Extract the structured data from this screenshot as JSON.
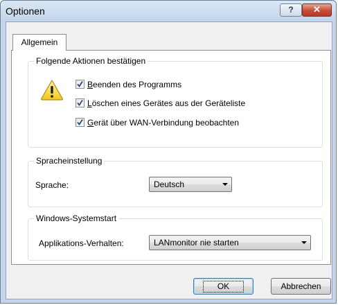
{
  "window": {
    "title": "Optionen",
    "help_label": "?",
    "close_label": "✕"
  },
  "tabs": [
    {
      "label": "Allgemein",
      "selected": true
    }
  ],
  "confirm_group": {
    "legend": "Folgende Aktionen bestätigen",
    "icon": "warning-icon",
    "items": [
      {
        "label": "Beenden des Programms",
        "checked": true
      },
      {
        "label": "Löschen eines Gerätes aus der Geräteliste",
        "checked": true
      },
      {
        "label": "Gerät über WAN-Verbindung beobachten",
        "checked": true
      }
    ]
  },
  "language_group": {
    "legend": "Spracheinstellung",
    "label": "Sprache:",
    "value": "Deutsch"
  },
  "startup_group": {
    "legend": "Windows-Systemstart",
    "label": "Applikations-Verhalten:",
    "value": "LANmonitor nie starten"
  },
  "buttons": {
    "ok": "OK",
    "cancel": "Abbrechen"
  }
}
